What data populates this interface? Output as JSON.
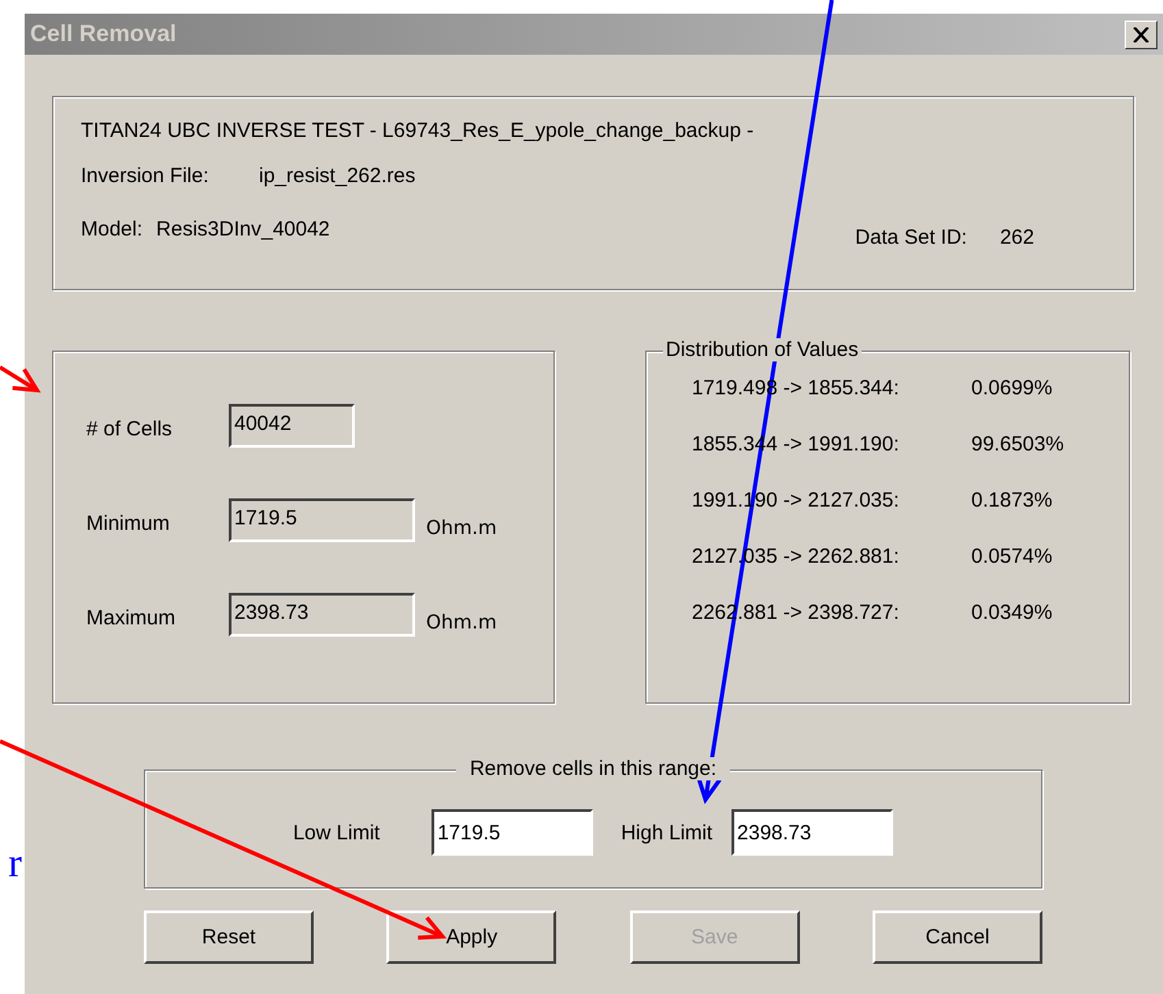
{
  "slide_text": "r",
  "window": {
    "title": "Cell Removal"
  },
  "info": {
    "title_line": "TITAN24 UBC INVERSE TEST - L69743_Res_E_ypole_change_backup -",
    "inversion_file": {
      "label": "Inversion File:",
      "value": "ip_resist_262.res"
    },
    "model": {
      "label": "Model:",
      "value": "Resis3DInv_40042"
    },
    "data_set_id": {
      "label": "Data Set ID:",
      "value": "262"
    }
  },
  "stats": [
    {
      "label": "# of Cells",
      "value": "40042"
    },
    {
      "label": "Minimum",
      "value": "1719.5",
      "unit": "Ohm.m"
    },
    {
      "label": "Maximum",
      "value": "2398.73",
      "unit": "Ohm.m"
    }
  ],
  "distribution": {
    "title": "Distribution of Values",
    "rows": [
      {
        "range": "1719.498 -> 1855.344:",
        "percent": "0.0699%"
      },
      {
        "range": "1855.344 -> 1991.190:",
        "percent": "99.6503%"
      },
      {
        "range": "1991.190 -> 2127.035:",
        "percent": "0.1873%"
      },
      {
        "range": "2127.035 -> 2262.881:",
        "percent": "0.0574%"
      },
      {
        "range": "2262.881 -> 2398.727:",
        "percent": "0.0349%"
      }
    ]
  },
  "range": {
    "title": "Remove cells in this range:",
    "low": {
      "label": "Low Limit",
      "value": "1719.5"
    },
    "high": {
      "label": "High Limit",
      "value": "2398.73"
    }
  },
  "buttons": [
    {
      "label": "Reset",
      "disabled": false
    },
    {
      "label": "Apply",
      "disabled": false
    },
    {
      "label": "Save",
      "disabled": true
    },
    {
      "label": "Cancel",
      "disabled": false
    }
  ],
  "annotations": [
    {
      "color": "#ff0000"
    },
    {
      "color": "#ff0000"
    },
    {
      "color": "#0000ff"
    }
  ]
}
